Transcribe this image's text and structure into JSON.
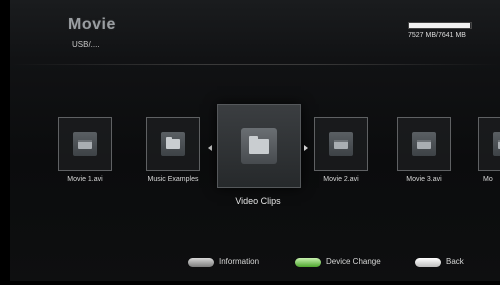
{
  "header": {
    "title": "Movie",
    "path": "USB/....",
    "storage_text": "7527 MB/7641 MB",
    "storage_fraction": 0.985
  },
  "items": [
    {
      "label": "Movie 1.avi",
      "icon": "movie-icon"
    },
    {
      "label": "Music Examples",
      "icon": "folder-icon"
    },
    {
      "label": "Video Clips",
      "icon": "folder-icon",
      "selected": true
    },
    {
      "label": "Movie 2.avi",
      "icon": "movie-icon"
    },
    {
      "label": "Movie 3.avi",
      "icon": "movie-icon"
    },
    {
      "label": "Mo",
      "icon": "movie-icon"
    }
  ],
  "footer": {
    "information": "Information",
    "device_change": "Device Change",
    "back": "Back"
  },
  "colors": {
    "background": "#111214",
    "green_button": "#4ea62e",
    "grey_button": "#9a9a9a",
    "white_button": "#e8e8e8"
  }
}
